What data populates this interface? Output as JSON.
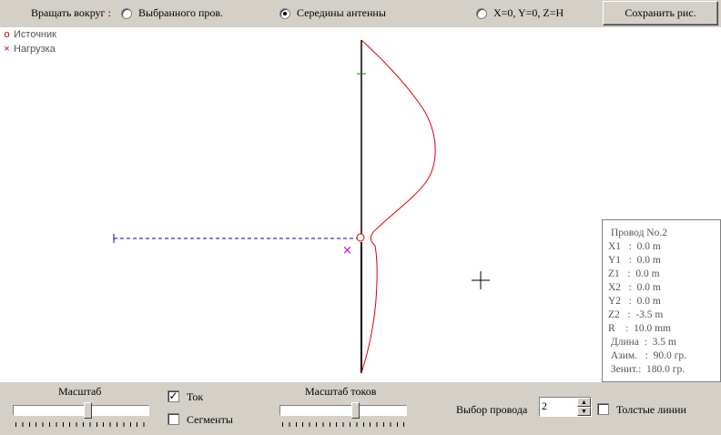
{
  "toolbar": {
    "rotate_label": "Вращать вокруг :",
    "options": [
      {
        "label": "Выбранного пров.",
        "checked": false
      },
      {
        "label": "Середины антенны",
        "checked": true
      },
      {
        "label": "X=0, Y=0, Z=H",
        "checked": false
      }
    ],
    "save_label": "Сохранить рис."
  },
  "legend": {
    "source": {
      "mark": "o",
      "label": "Источник"
    },
    "load": {
      "mark": "×",
      "label": "Нагрузка"
    }
  },
  "wire_info": {
    "title": "Провод No.2",
    "lines": [
      "X1   :  0.0 m",
      "Y1   :  0.0 m",
      "Z1   :  0.0 m",
      "X2   :  0.0 m",
      "Y2   :  0.0 m",
      "Z2   :  -3.5 m",
      "R    :  10.0 mm",
      " Длина  :  3.5 m",
      " Азим.   :  90.0 гр.",
      " Зенит.:  180.0 гр."
    ]
  },
  "bottom": {
    "scale_label": "Масштаб",
    "scale_position": 0.55,
    "current_label": "Ток",
    "current_checked": true,
    "segments_label": "Сегменты",
    "segments_checked": false,
    "current_scale_label": "Масштаб токов",
    "current_scale_position": 0.6,
    "wire_select_label": "Выбор провода",
    "wire_select_value": "2",
    "thick_lines_label": "Толстые линии",
    "thick_lines_checked": false
  },
  "colors": {
    "current_curve": "#e00000",
    "feeder_line": "#0000c0",
    "load_marker": "#cc00cc",
    "segment_tick": "#008000"
  }
}
